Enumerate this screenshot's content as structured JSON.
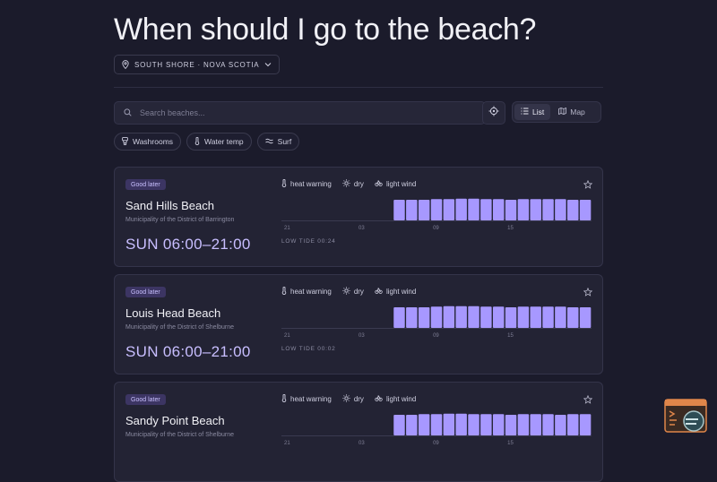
{
  "page": {
    "title": "When should I go to the beach?",
    "region": "SOUTH SHORE · NOVA SCOTIA"
  },
  "search": {
    "placeholder": "Search beaches..."
  },
  "view_toggle": {
    "list_label": "List",
    "map_label": "Map",
    "active": "List"
  },
  "filters": [
    {
      "label": "Washrooms",
      "icon": "toilet-icon"
    },
    {
      "label": "Water temp",
      "icon": "thermometer-icon"
    },
    {
      "label": "Surf",
      "icon": "waves-icon"
    }
  ],
  "colors": {
    "accent": "#a798ff",
    "badge_bg": "#3c3563",
    "background": "#1b1b2b",
    "card": "#232334"
  },
  "beaches": [
    {
      "badge": "Good later",
      "name": "Sand Hills Beach",
      "municipality": "Municipality of the District of Barrington",
      "window": "SUN 06:00–21:00",
      "tags": [
        "heat warning",
        "dry",
        "light wind"
      ],
      "tide": "LOW TIDE 00:24"
    },
    {
      "badge": "Good later",
      "name": "Louis Head Beach",
      "municipality": "Municipality of the District of Shelburne",
      "window": "SUN 06:00–21:00",
      "tags": [
        "heat warning",
        "dry",
        "light wind"
      ],
      "tide": "LOW TIDE 00:02"
    },
    {
      "badge": "Good later",
      "name": "Sandy Point Beach",
      "municipality": "Municipality of the District of Shelburne",
      "window": "",
      "tags": [
        "heat warning",
        "dry",
        "light wind"
      ],
      "tide": ""
    }
  ],
  "chart_data": [
    {
      "type": "bar",
      "x_ticks": [
        "21",
        "03",
        "09",
        "15"
      ],
      "hours": [
        "21",
        "22",
        "23",
        "00",
        "01",
        "02",
        "03",
        "04",
        "05",
        "06",
        "07",
        "08",
        "09",
        "10",
        "11",
        "12",
        "13",
        "14",
        "15",
        "16",
        "17",
        "18",
        "19",
        "20",
        "21"
      ],
      "values": [
        0,
        0,
        0,
        0,
        0,
        0,
        0,
        0,
        0,
        0.92,
        0.92,
        0.92,
        0.95,
        0.95,
        0.97,
        0.97,
        0.95,
        0.95,
        0.92,
        0.95,
        0.95,
        0.95,
        0.95,
        0.92,
        0.92
      ]
    },
    {
      "type": "bar",
      "x_ticks": [
        "21",
        "03",
        "09",
        "15"
      ],
      "hours": [
        "21",
        "22",
        "23",
        "00",
        "01",
        "02",
        "03",
        "04",
        "05",
        "06",
        "07",
        "08",
        "09",
        "10",
        "11",
        "12",
        "13",
        "14",
        "15",
        "16",
        "17",
        "18",
        "19",
        "20",
        "21"
      ],
      "values": [
        0,
        0,
        0,
        0,
        0,
        0,
        0,
        0,
        0,
        0.92,
        0.92,
        0.92,
        0.95,
        0.97,
        0.97,
        0.97,
        0.95,
        0.95,
        0.92,
        0.95,
        0.95,
        0.95,
        0.95,
        0.92,
        0.92
      ]
    },
    {
      "type": "bar",
      "x_ticks": [
        "21",
        "03",
        "09",
        "15"
      ],
      "hours": [
        "21",
        "22",
        "23",
        "00",
        "01",
        "02",
        "03",
        "04",
        "05",
        "06",
        "07",
        "08",
        "09",
        "10",
        "11",
        "12",
        "13",
        "14",
        "15",
        "16",
        "17",
        "18",
        "19",
        "20",
        "21"
      ],
      "values": [
        0,
        0,
        0,
        0,
        0,
        0,
        0,
        0,
        0,
        0.92,
        0.92,
        0.95,
        0.95,
        0.97,
        0.97,
        0.95,
        0.95,
        0.95,
        0.92,
        0.95,
        0.95,
        0.95,
        0.92,
        0.95,
        0.95
      ]
    }
  ]
}
